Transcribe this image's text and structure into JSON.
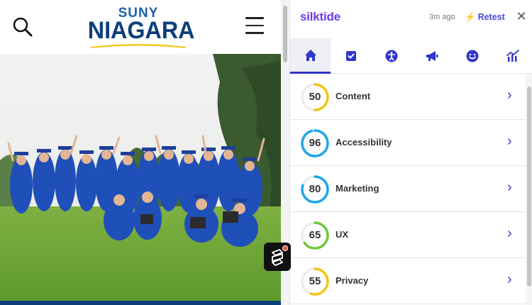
{
  "site": {
    "logo_top": "SUNY",
    "logo_bottom": "NIAGARA",
    "colors": {
      "brand_blue": "#0d3f7a",
      "brand_yellow": "#f5c518"
    },
    "icons": {
      "search": "search-icon",
      "menu": "hamburger-menu-icon",
      "launcher": "silktide-launcher-icon"
    }
  },
  "panel": {
    "brand": "silktide",
    "updated": "3m ago",
    "retest_label": "Retest",
    "close_glyph": "✕",
    "tabs": [
      {
        "name": "home",
        "icon": "home-icon",
        "active": true
      },
      {
        "name": "content",
        "icon": "checkbox-icon",
        "active": false
      },
      {
        "name": "accessibility",
        "icon": "accessibility-icon",
        "active": false
      },
      {
        "name": "marketing",
        "icon": "megaphone-icon",
        "active": false
      },
      {
        "name": "ux",
        "icon": "smiley-icon",
        "active": false
      },
      {
        "name": "analytics",
        "icon": "bar-chart-icon",
        "active": false
      }
    ],
    "scores": [
      {
        "label": "Content",
        "score": "50",
        "value": 50,
        "color": "#f5c518"
      },
      {
        "label": "Accessibility",
        "score": "96",
        "value": 96,
        "color": "#1fa6e8"
      },
      {
        "label": "Marketing",
        "score": "80",
        "value": 80,
        "color": "#1fa6e8"
      },
      {
        "label": "UX",
        "score": "65",
        "value": 65,
        "color": "#6cc93a"
      },
      {
        "label": "Privacy",
        "score": "55",
        "value": 55,
        "color": "#f5c518"
      }
    ],
    "accent": "#2f36c9"
  }
}
